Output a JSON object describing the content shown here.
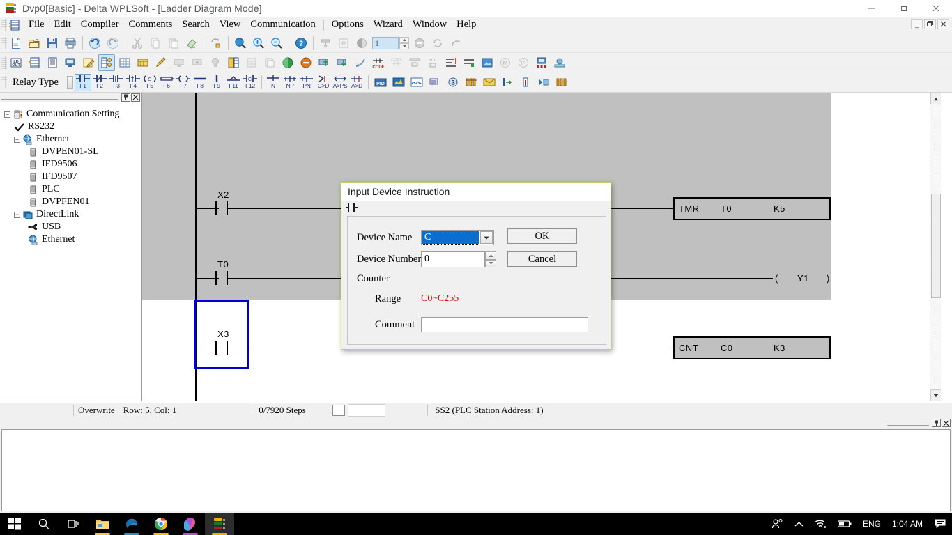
{
  "window": {
    "title": "Dvp0[Basic] - Delta WPLSoft - [Ladder Diagram Mode]",
    "app_icon": "wplsoft-icon",
    "minimize": "—",
    "maximize": "❐",
    "close": "✕"
  },
  "mdi": {
    "minimize": "_",
    "restore": "❐",
    "close": "✕"
  },
  "menu": {
    "items": [
      {
        "label": "File"
      },
      {
        "label": "Edit"
      },
      {
        "label": "Compiler"
      },
      {
        "label": "Comments"
      },
      {
        "label": "Search"
      },
      {
        "label": "View"
      },
      {
        "label": "Communication"
      },
      {
        "label": "Options"
      },
      {
        "label": "Wizard"
      },
      {
        "label": "Window"
      },
      {
        "label": "Help"
      }
    ]
  },
  "toolbar1": {
    "items": [
      "new-file-icon",
      "open-file-icon",
      "save-icon",
      "print-icon",
      "undo-icon",
      "redo-icon",
      "cut-icon",
      "copy-icon",
      "paste-icon",
      "eraser-icon",
      "find-replace-icon",
      "zoom-icon",
      "zoom-in-icon",
      "zoom-out-icon",
      "help-icon",
      "download-plc-icon",
      "simulator-icon",
      "run-stop-icon",
      "stop-icon",
      "refresh-icon",
      "redo-arrow-icon"
    ],
    "spinner_value": "1"
  },
  "toolbar2": {
    "items": [
      "ladder-out-icon",
      "ladder-view-icon",
      "instruction-view-icon",
      "monitor-icon",
      "edit-mode-icon",
      "comm-setting-icon",
      "grid-icon",
      "register-icon",
      "pen-icon",
      "pc-to-plc-icon",
      "plc-to-pc-icon",
      "bulb-icon",
      "program-compare-icon",
      "ladder-compare-icon",
      "copy-view-icon",
      "run-icon",
      "stop-icon",
      "upload-icon",
      "download-icon",
      "satellite-icon",
      "code-contact-icon",
      "code-bits-icon",
      "align-icon",
      "step-icon",
      "trim-icon",
      "picture-icon",
      "find-m-icon",
      "find-ip-icon",
      "network-icon",
      "settings-icon"
    ]
  },
  "relaybar": {
    "label": "Relay Type",
    "buttons": [
      {
        "key": "F1",
        "name": "normally-open-contact",
        "selected": true
      },
      {
        "key": "F2",
        "name": "normally-closed-contact",
        "selected": false
      },
      {
        "key": "F3",
        "name": "rising-edge-contact",
        "selected": false
      },
      {
        "key": "F4",
        "name": "falling-edge-contact",
        "selected": false
      },
      {
        "key": "F5",
        "name": "set-coil",
        "selected": false
      },
      {
        "key": "F6",
        "name": "horizontal-line",
        "selected": false
      },
      {
        "key": "F7",
        "name": "output-coil",
        "selected": false
      },
      {
        "key": "F8",
        "name": "horizontal-link",
        "selected": false
      },
      {
        "key": "F9",
        "name": "vertical-link",
        "selected": false
      },
      {
        "key": "F11",
        "name": "invert-contact",
        "selected": false
      },
      {
        "key": "F12",
        "name": "compare-contact",
        "selected": false
      },
      {
        "key": "N",
        "name": "negate-icon",
        "selected": false
      },
      {
        "key": "NP",
        "name": "rising-pulse-icon",
        "selected": false
      },
      {
        "key": "PN",
        "name": "falling-pulse-icon",
        "selected": false
      },
      {
        "key": "C>D",
        "name": "contact-to-device-icon",
        "selected": false
      },
      {
        "key": "A>PS",
        "name": "a-to-ps-icon",
        "selected": false
      },
      {
        "key": "A>D",
        "name": "a-to-d-icon",
        "selected": false
      }
    ],
    "extra_icons": [
      "pid-icon",
      "chart-icon",
      "waveform-icon",
      "sort-icon",
      "dollar-icon",
      "bar-data-icon",
      "mail-icon",
      "insert-row-icon",
      "thermometer-icon",
      "step-run-icon",
      "bar-chart-icon"
    ]
  },
  "tree": {
    "caption_buttons": [
      "pin-icon",
      "close-icon"
    ],
    "nodes": [
      {
        "label": "Communication Setting",
        "level": 0,
        "expander": "−",
        "icon": "plc-device-icon"
      },
      {
        "label": "RS232",
        "level": 1,
        "expander": "",
        "icon": "check-icon"
      },
      {
        "label": "Ethernet",
        "level": 1,
        "expander": "−",
        "icon": "ethernet-icon"
      },
      {
        "label": "DVPEN01-SL",
        "level": 2,
        "expander": "",
        "icon": "module-icon"
      },
      {
        "label": "IFD9506",
        "level": 2,
        "expander": "",
        "icon": "module-icon"
      },
      {
        "label": "IFD9507",
        "level": 2,
        "expander": "",
        "icon": "module-icon"
      },
      {
        "label": "PLC",
        "level": 2,
        "expander": "",
        "icon": "module-icon"
      },
      {
        "label": "DVPFEN01",
        "level": 2,
        "expander": "",
        "icon": "module-icon"
      },
      {
        "label": "DirectLink",
        "level": 1,
        "expander": "−",
        "icon": "directlink-icon"
      },
      {
        "label": "USB",
        "level": 2,
        "expander": "",
        "icon": "usb-icon"
      },
      {
        "label": "Ethernet",
        "level": 2,
        "expander": "",
        "icon": "ethernet-icon"
      }
    ]
  },
  "ladder": {
    "rungs": [
      {
        "contact_label": "X2",
        "instruction": {
          "op": "TMR",
          "device": "T0",
          "constant": "K5"
        }
      },
      {
        "contact_label": "T0",
        "coil": {
          "open": "(",
          "device": "Y1",
          "close": ")"
        }
      },
      {
        "contact_label": "X3",
        "instruction": {
          "op": "CNT",
          "device": "C0",
          "constant": "K3"
        }
      }
    ]
  },
  "dialog": {
    "title": "Input Device Instruction",
    "symbol": "normally-open-contact-icon",
    "device_name_label": "Device Name",
    "device_name_value": "C",
    "device_number_label": "Device Number",
    "device_number_value": "0",
    "type_label": "Counter",
    "range_label": "Range",
    "range_value": "C0~C255",
    "comment_label": "Comment",
    "comment_value": "",
    "ok_label": "OK",
    "cancel_label": "Cancel"
  },
  "statusbar": {
    "mode": "Overwrite",
    "position": "Row: 5, Col: 1",
    "steps": "0/7920 Steps",
    "plc": "SS2 (PLC Station Address: 1)"
  },
  "taskbar": {
    "items": [
      {
        "name": "start-button",
        "icon": "windows-logo-icon"
      },
      {
        "name": "search-button",
        "icon": "search-icon"
      },
      {
        "name": "task-view-button",
        "icon": "task-view-icon"
      },
      {
        "name": "file-explorer-button",
        "icon": "folder-icon"
      },
      {
        "name": "edge-button",
        "icon": "edge-icon"
      },
      {
        "name": "chrome-button",
        "icon": "chrome-icon"
      },
      {
        "name": "app-button",
        "icon": "balloon-icon"
      },
      {
        "name": "wplsoft-button",
        "icon": "wplsoft-icon"
      }
    ],
    "tray": {
      "people": "people-icon",
      "chevron": "chevron-up-icon",
      "wifi": "wifi-icon",
      "battery": "battery-icon",
      "language": "ENG",
      "time": "1:04 AM",
      "notifications": "notification-icon"
    }
  },
  "colors": {
    "accent": "#0a6ed1",
    "range_text": "#d01010",
    "cursor": "#0000d0",
    "canvas_grey": "#c0c0c0",
    "dialog_border": "#b5d36a"
  }
}
